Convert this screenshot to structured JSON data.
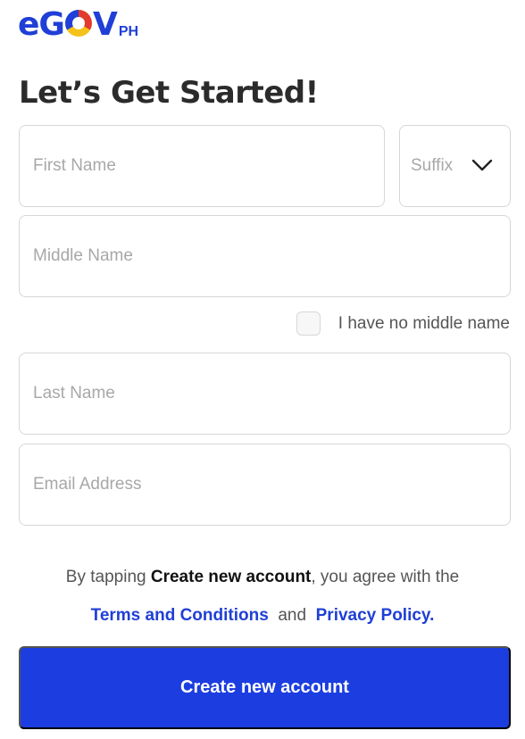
{
  "logo": {
    "e": "e",
    "g": "G",
    "o": "O",
    "v": "V",
    "ph": "PH"
  },
  "title": "Let’s Get Started!",
  "form": {
    "first_name_placeholder": "First Name",
    "suffix_label": "Suffix",
    "middle_name_placeholder": "Middle Name",
    "no_middle_name_label": "I have no middle name",
    "no_middle_name_checked": false,
    "last_name_placeholder": "Last Name",
    "email_placeholder": "Email Address"
  },
  "agreement": {
    "prefix": "By tapping ",
    "emphasis": "Create new account",
    "suffix": ", you agree with the",
    "terms_link": "Terms and Conditions",
    "and": "and",
    "privacy_link": "Privacy Policy."
  },
  "cta_label": "Create new account",
  "colors": {
    "brand_blue": "#1c3ee0",
    "link_blue": "#1f3fd6",
    "border": "#d7d7d7",
    "placeholder": "#a8a8a8"
  },
  "icons": {
    "suffix_dropdown": "chevron-down-icon"
  }
}
